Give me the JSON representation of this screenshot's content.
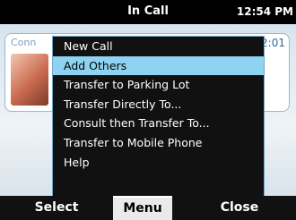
{
  "status_bar": {
    "title": "In Call",
    "time": "12:54 PM"
  },
  "call_card": {
    "contact_name": "Conn",
    "duration": "2:01"
  },
  "menu": {
    "items": [
      {
        "label": "New Call",
        "selected": false
      },
      {
        "label": "Add Others",
        "selected": true
      },
      {
        "label": "Transfer to Parking Lot",
        "selected": false
      },
      {
        "label": "Transfer Directly To...",
        "selected": false
      },
      {
        "label": "Consult then Transfer To...",
        "selected": false
      },
      {
        "label": "Transfer to Mobile Phone",
        "selected": false
      },
      {
        "label": "Help",
        "selected": false
      }
    ]
  },
  "softkeys": {
    "left": "Select",
    "center": "Menu",
    "right": "Close"
  },
  "colors": {
    "highlight": "#8ed3f1",
    "menu_border": "#6fa8c8",
    "background": "#000000"
  }
}
